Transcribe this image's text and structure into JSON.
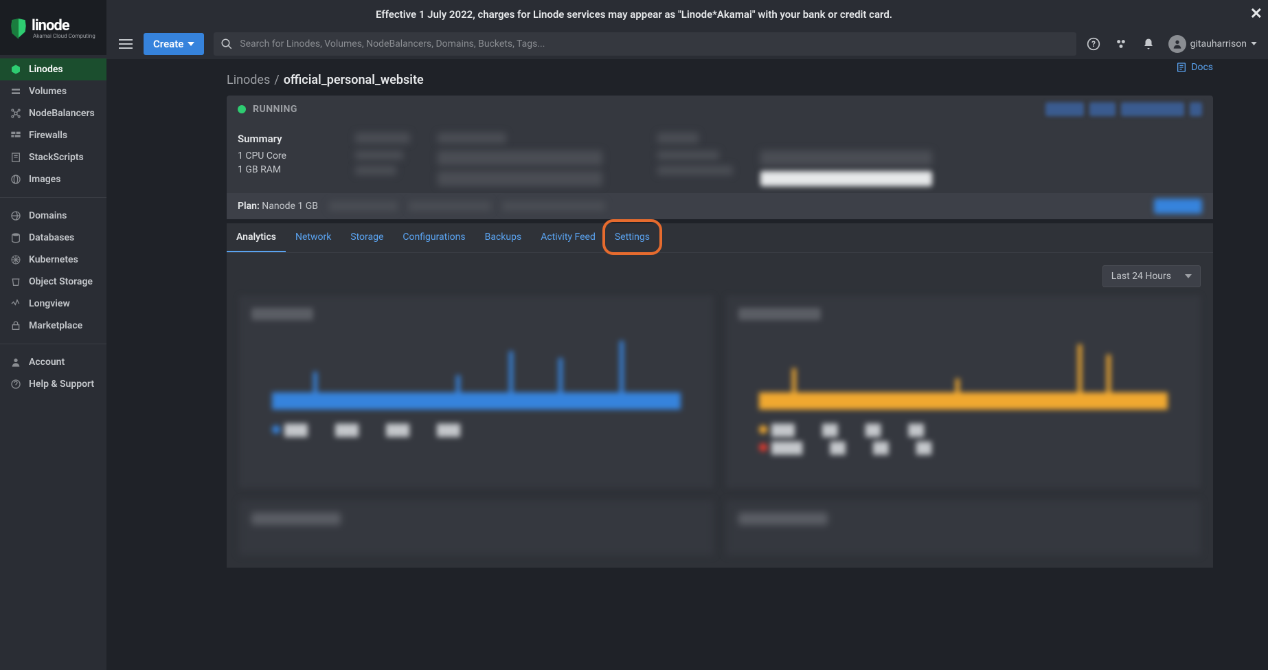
{
  "banner": {
    "text": "Effective 1 July 2022, charges for Linode services may appear as \"Linode*Akamai\" with your bank or credit card."
  },
  "logo": {
    "name": "linode",
    "tagline": "Akamai Cloud Computing"
  },
  "topbar": {
    "create_label": "Create",
    "search_placeholder": "Search for Linodes, Volumes, NodeBalancers, Domains, Buckets, Tags...",
    "username": "gitauharrison"
  },
  "sidebar": {
    "groups": [
      {
        "items": [
          {
            "label": "Linodes",
            "icon": "cube-icon",
            "active": true
          },
          {
            "label": "Volumes",
            "icon": "volume-icon"
          },
          {
            "label": "NodeBalancers",
            "icon": "nodebalancer-icon"
          },
          {
            "label": "Firewalls",
            "icon": "firewall-icon"
          },
          {
            "label": "StackScripts",
            "icon": "script-icon"
          },
          {
            "label": "Images",
            "icon": "image-icon"
          }
        ]
      },
      {
        "items": [
          {
            "label": "Domains",
            "icon": "globe-icon"
          },
          {
            "label": "Databases",
            "icon": "database-icon"
          },
          {
            "label": "Kubernetes",
            "icon": "kubernetes-icon"
          },
          {
            "label": "Object Storage",
            "icon": "bucket-icon"
          },
          {
            "label": "Longview",
            "icon": "longview-icon"
          },
          {
            "label": "Marketplace",
            "icon": "marketplace-icon"
          }
        ]
      },
      {
        "items": [
          {
            "label": "Account",
            "icon": "account-icon"
          },
          {
            "label": "Help & Support",
            "icon": "help-icon"
          }
        ]
      }
    ]
  },
  "breadcrumb": {
    "root": "Linodes",
    "current": "official_personal_website"
  },
  "docs_label": "Docs",
  "status": {
    "label": "RUNNING"
  },
  "summary": {
    "heading": "Summary",
    "cpu": "1 CPU Core",
    "ram": "1 GB RAM"
  },
  "plan": {
    "label": "Plan:",
    "value": "Nanode 1 GB"
  },
  "tabs": [
    {
      "label": "Analytics",
      "active": true
    },
    {
      "label": "Network"
    },
    {
      "label": "Storage"
    },
    {
      "label": "Configurations"
    },
    {
      "label": "Backups"
    },
    {
      "label": "Activity Feed"
    },
    {
      "label": "Settings",
      "highlight": true
    }
  ],
  "time_range": "Last 24 Hours",
  "chart_data": [
    {
      "type": "area",
      "title": "CPU (%)",
      "series": [
        {
          "name": "CPU",
          "color": "#3683dc"
        }
      ],
      "note": "values obscured/blurred in source"
    },
    {
      "type": "area",
      "title": "Network (b/s)",
      "series": [
        {
          "name": "In",
          "color": "#f0a830"
        },
        {
          "name": "Out",
          "color": "#e0392e"
        }
      ],
      "note": "values obscured/blurred in source"
    }
  ]
}
